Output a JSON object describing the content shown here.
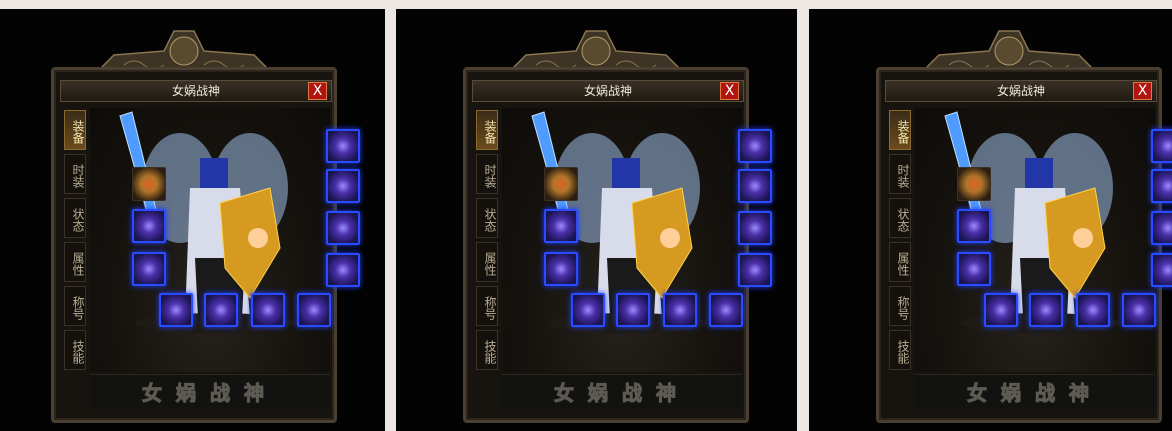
{
  "panels": [
    {
      "title": "女娲战神",
      "close_label": "X",
      "tabs": [
        {
          "label": "装备",
          "active": true
        },
        {
          "label": "时装"
        },
        {
          "label": "状态"
        },
        {
          "label": "属性"
        },
        {
          "label": "称号"
        },
        {
          "label": "技能"
        }
      ],
      "name_banner": "女娲战神"
    },
    {
      "title": "女娲战神",
      "close_label": "X",
      "tabs": [
        {
          "label": "装备",
          "active": true
        },
        {
          "label": "时装"
        },
        {
          "label": "状态"
        },
        {
          "label": "属性"
        },
        {
          "label": "称号"
        },
        {
          "label": "技能"
        }
      ],
      "name_banner": "女娲战神"
    },
    {
      "title": "女娲战神",
      "close_label": "X",
      "tabs": [
        {
          "label": "装备",
          "active": true
        },
        {
          "label": "时装"
        },
        {
          "label": "状态"
        },
        {
          "label": "属性"
        },
        {
          "label": "称号"
        },
        {
          "label": "技能"
        }
      ],
      "name_banner": "女娲战神"
    }
  ],
  "colors": {
    "slot_glow": "#2a4cff",
    "close_button": "#b0150f",
    "active_tab": "#6b4b1c"
  },
  "equipment_slots": [
    "medal-icon",
    "bracelet-left-icon",
    "ring-left-icon",
    "necklace-icon",
    "helmet-ornament-icon",
    "bracelet-right-icon",
    "ring-right-icon",
    "belt-icon",
    "boots-icon",
    "armor-gem-icon",
    "orb-icon"
  ]
}
